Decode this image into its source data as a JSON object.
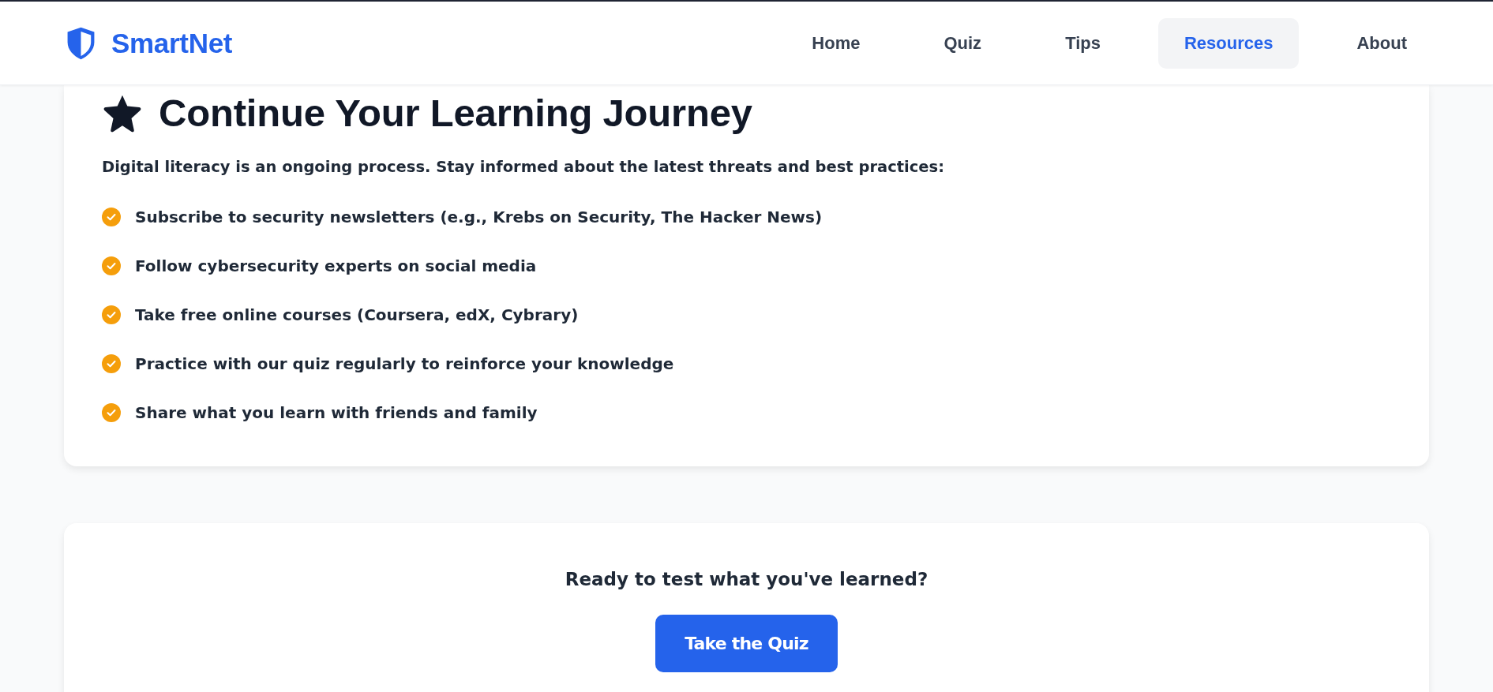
{
  "header": {
    "logo": "SmartNet",
    "nav": [
      {
        "label": "Home",
        "selected": false
      },
      {
        "label": "Quiz",
        "selected": false
      },
      {
        "label": "Tips",
        "selected": false
      },
      {
        "label": "Resources",
        "selected": true
      },
      {
        "label": "About",
        "selected": false
      }
    ]
  },
  "learning_card": {
    "title": "Continue Your Learning Journey",
    "intro": "Digital literacy is an ongoing process. Stay informed about the latest threats and best practices:",
    "items": [
      "Subscribe to security newsletters (e.g., Krebs on Security, The Hacker News)",
      "Follow cybersecurity experts on social media",
      "Take free online courses (Coursera, edX, Cybrary)",
      "Practice with our quiz regularly to reinforce your knowledge",
      "Share what you learn with friends and family"
    ]
  },
  "cta_card": {
    "prompt": "Ready to test what you've learned?",
    "button": "Take the Quiz"
  }
}
